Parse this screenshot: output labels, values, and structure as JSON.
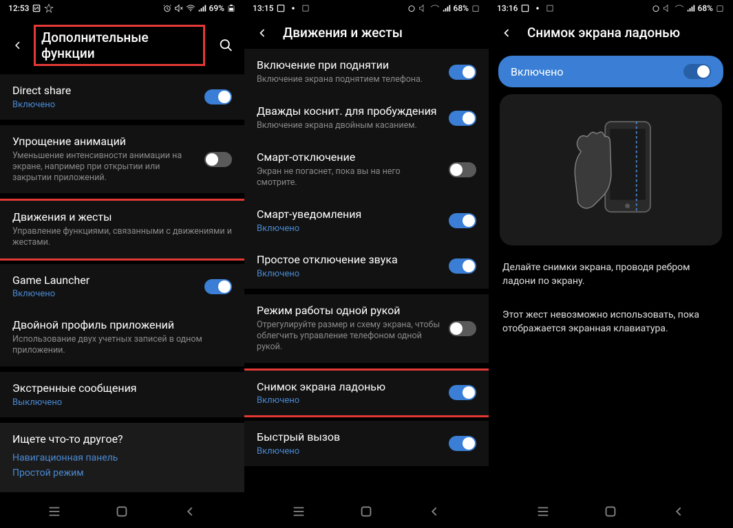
{
  "screen1": {
    "time": "12:53",
    "battery": "69%",
    "title": "Дополнительные функции",
    "items": [
      {
        "title": "Direct share",
        "status": "Включено",
        "toggle": "on"
      },
      {
        "title": "Упрощение анимаций",
        "subtitle": "Уменьшение интенсивности анимации на экране, например при открытии или закрытии приложений.",
        "toggle": "off"
      },
      {
        "title": "Движения и жесты",
        "subtitle": "Управление функциями, связанными с движениями и жестами."
      },
      {
        "title": "Game Launcher",
        "status": "Включено",
        "toggle": "on"
      },
      {
        "title": "Двойной профиль приложений",
        "subtitle": "Использование двух учетных записей в одном приложении."
      },
      {
        "title": "Экстренные сообщения",
        "status": "Выключено"
      }
    ],
    "lookup": {
      "title": "Ищете что-то другое?",
      "link1": "Навигационная панель",
      "link2": "Простой режим"
    }
  },
  "screen2": {
    "time": "13:15",
    "battery": "68%",
    "title": "Движения и жесты",
    "items": [
      {
        "title": "Включение при поднятии",
        "subtitle": "Включение экрана поднятием телефона.",
        "toggle": "on"
      },
      {
        "title": "Дважды коснит. для пробуждения",
        "subtitle": "Включение экрана двойным касанием.",
        "toggle": "on"
      },
      {
        "title": "Смарт-отключение",
        "subtitle": "Экран не погаснет, пока вы на него смотрите.",
        "toggle": "off"
      },
      {
        "title": "Смарт-уведомления",
        "status": "Включено",
        "toggle": "on"
      },
      {
        "title": "Простое отключение звука",
        "status": "Включено",
        "toggle": "on"
      },
      {
        "title": "Режим работы одной рукой",
        "subtitle": "Отрегулируйте размер и схему экрана, чтобы облегчить управление телефоном одной рукой.",
        "toggle": "off"
      },
      {
        "title": "Снимок экрана ладонью",
        "status": "Включено",
        "toggle": "on"
      },
      {
        "title": "Быстрый вызов",
        "status": "Включено",
        "toggle": "on"
      }
    ]
  },
  "screen3": {
    "time": "13:16",
    "battery": "68%",
    "title": "Снимок экрана ладонью",
    "enabled_label": "Включено",
    "desc1": "Делайте снимки экрана, проводя ребром ладони по экрану.",
    "desc2": "Этот жест невозможно использовать, пока отображается экранная клавиатура."
  }
}
